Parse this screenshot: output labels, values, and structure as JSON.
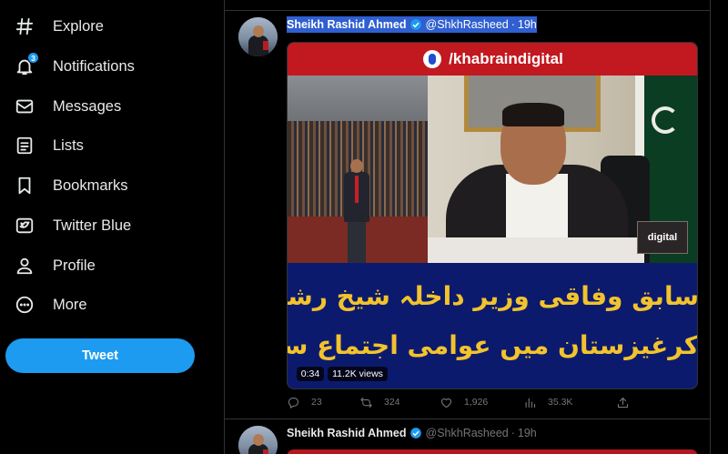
{
  "sidebar": {
    "items": [
      {
        "label": "Explore",
        "icon": "hashtag-icon"
      },
      {
        "label": "Notifications",
        "icon": "bell-icon",
        "badge": "3"
      },
      {
        "label": "Messages",
        "icon": "envelope-icon"
      },
      {
        "label": "Lists",
        "icon": "list-icon"
      },
      {
        "label": "Bookmarks",
        "icon": "bookmark-icon"
      },
      {
        "label": "Twitter Blue",
        "icon": "twitter-blue-icon"
      },
      {
        "label": "Profile",
        "icon": "person-icon"
      },
      {
        "label": "More",
        "icon": "more-circle-icon"
      }
    ],
    "tweet_button": "Tweet"
  },
  "tweets": [
    {
      "name": "Sheikh Rashid Ahmed",
      "handle": "@ShkhRasheed",
      "separator": "·",
      "time": "19h",
      "media": {
        "watermark": "/khabraindigital",
        "channel_logo": "digital",
        "caption_line1": "سابق وفاقی وزیر داخلہ شیخ رشید احمد کا بشکیک",
        "caption_line2": "کرغیزستان میں عوامی اجتماع سے خطاب",
        "duration": "0:34",
        "views": "11.2K views"
      },
      "stats": {
        "replies": "23",
        "retweets": "324",
        "likes": "1,926",
        "views": "35.3K"
      }
    },
    {
      "name": "Sheikh Rashid Ahmed",
      "handle": "@ShkhRasheed",
      "separator": "·",
      "time": "19h"
    }
  ],
  "colors": {
    "background": "#000000",
    "accent": "#1d9bf0",
    "selection": "#2f5fd0",
    "caption_text": "#f2c32c",
    "media_blue": "#0c1a6e",
    "media_red": "#c2181f"
  }
}
